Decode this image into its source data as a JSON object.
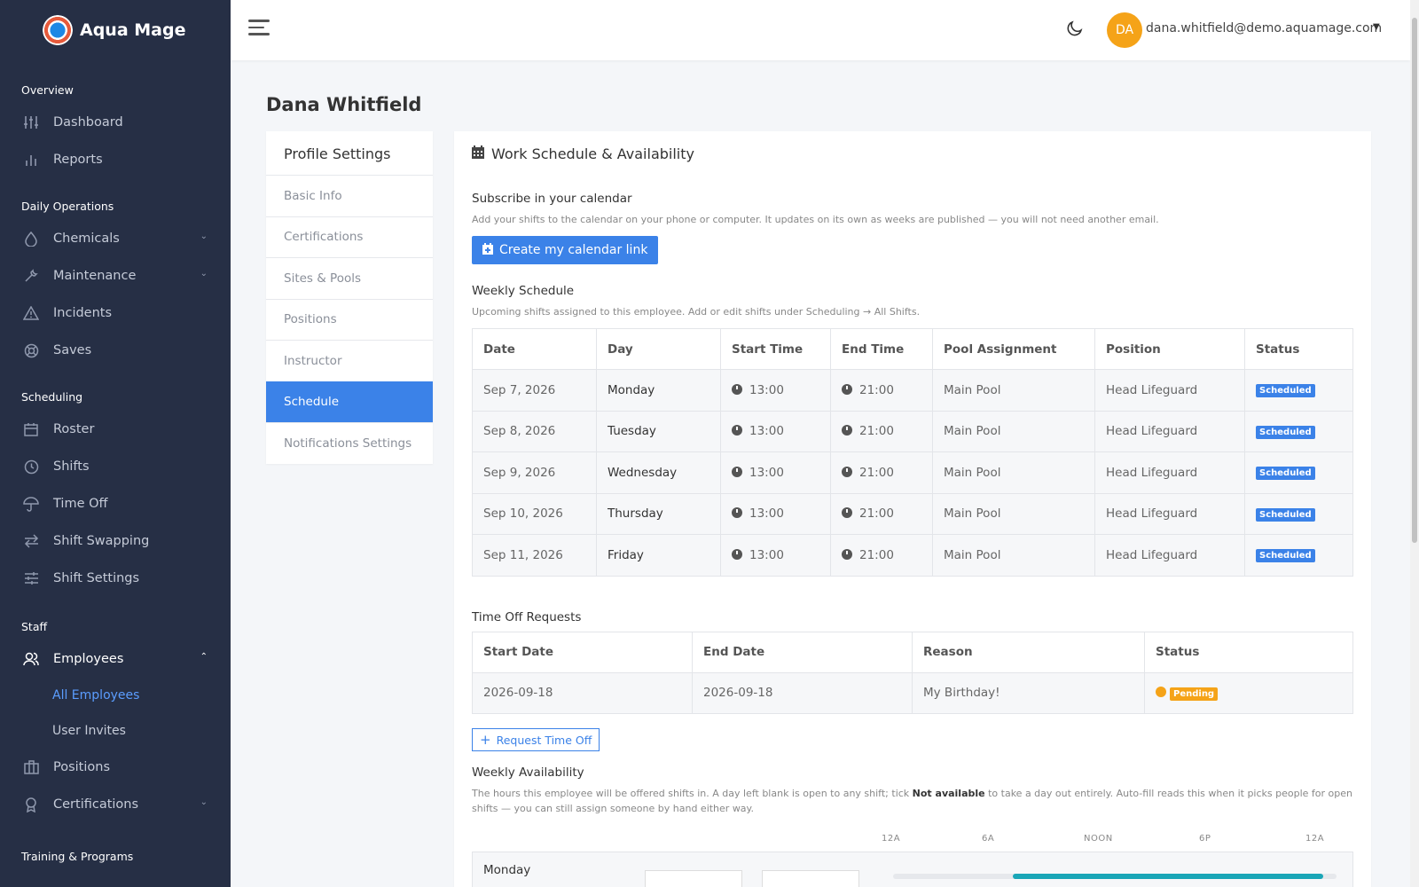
{
  "brand": {
    "name": "Aqua Mage"
  },
  "sidebar": {
    "sections": {
      "overview": "Overview",
      "daily_ops": "Daily Operations",
      "scheduling": "Scheduling",
      "staff": "Staff",
      "training": "Training & Programs"
    },
    "items": {
      "dashboard": "Dashboard",
      "reports": "Reports",
      "chemicals": "Chemicals",
      "maintenance": "Maintenance",
      "incidents": "Incidents",
      "saves": "Saves",
      "roster": "Roster",
      "shifts": "Shifts",
      "time_off": "Time Off",
      "shift_swapping": "Shift Swapping",
      "shift_settings": "Shift Settings",
      "employees": "Employees",
      "all_employees": "All Employees",
      "user_invites": "User Invites",
      "positions": "Positions",
      "certifications": "Certifications"
    }
  },
  "topbar": {
    "avatar_initials": "DA",
    "user_email": "dana.whitfield@demo.aquamage.com"
  },
  "page": {
    "title": "Dana Whitfield"
  },
  "settings_menu": {
    "title": "Profile Settings",
    "items": [
      "Basic Info",
      "Certifications",
      "Sites & Pools",
      "Positions",
      "Instructor",
      "Schedule",
      "Notifications Settings"
    ]
  },
  "schedule_card": {
    "title": "Work Schedule & Availability",
    "subscribe": {
      "heading": "Subscribe in your calendar",
      "hint": "Add your shifts to the calendar on your phone or computer. It updates on its own as weeks are published — you will not need another email.",
      "button": "Create my calendar link"
    },
    "weekly": {
      "heading": "Weekly Schedule",
      "hint": "Upcoming shifts assigned to this employee. Add or edit shifts under Scheduling → All Shifts.",
      "columns": [
        "Date",
        "Day",
        "Start Time",
        "End Time",
        "Pool Assignment",
        "Position",
        "Status"
      ],
      "rows": [
        {
          "date": "Sep 7, 2026",
          "day": "Monday",
          "start": "13:00",
          "end": "21:00",
          "pool": "Main Pool",
          "position": "Head Lifeguard",
          "status": "Scheduled"
        },
        {
          "date": "Sep 8, 2026",
          "day": "Tuesday",
          "start": "13:00",
          "end": "21:00",
          "pool": "Main Pool",
          "position": "Head Lifeguard",
          "status": "Scheduled"
        },
        {
          "date": "Sep 9, 2026",
          "day": "Wednesday",
          "start": "13:00",
          "end": "21:00",
          "pool": "Main Pool",
          "position": "Head Lifeguard",
          "status": "Scheduled"
        },
        {
          "date": "Sep 10, 2026",
          "day": "Thursday",
          "start": "13:00",
          "end": "21:00",
          "pool": "Main Pool",
          "position": "Head Lifeguard",
          "status": "Scheduled"
        },
        {
          "date": "Sep 11, 2026",
          "day": "Friday",
          "start": "13:00",
          "end": "21:00",
          "pool": "Main Pool",
          "position": "Head Lifeguard",
          "status": "Scheduled"
        }
      ]
    },
    "time_off": {
      "heading": "Time Off Requests",
      "columns": [
        "Start Date",
        "End Date",
        "Reason",
        "Status"
      ],
      "rows": [
        {
          "start": "2026-09-18",
          "end": "2026-09-18",
          "reason": "My Birthday!",
          "status": "Pending"
        }
      ],
      "button": "Request Time Off"
    },
    "availability": {
      "heading": "Weekly Availability",
      "hint_before": "The hours this employee will be offered shifts in. A day left blank is open to any shift; tick ",
      "hint_bold": "Not available",
      "hint_after": " to take a day out entirely. Auto-fill reads this when it picks people for open shifts — you can still assign someone by hand either way.",
      "axis": [
        "12A",
        "6A",
        "NOON",
        "6P",
        "12A"
      ],
      "days": [
        {
          "day": "Monday",
          "range_start": 0.27,
          "range_end": 0.97
        }
      ]
    }
  },
  "colors": {
    "sidebar_bg": "#262f45",
    "accent": "#3b82e8",
    "warning": "#f5a318",
    "availability": "#1aa6b7"
  }
}
